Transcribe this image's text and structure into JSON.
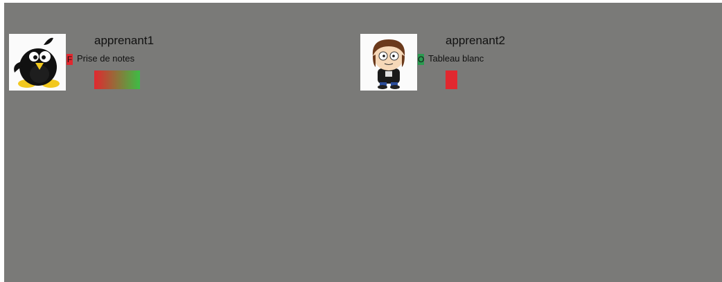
{
  "students": [
    {
      "name": "apprenant1",
      "avatar_icon": "penguin-avatar-icon",
      "status_letter": "F",
      "status_color": "#e1282f",
      "activity": "Prise de notes",
      "progress_gradient": [
        "#e1282f",
        "#3dbd45"
      ],
      "progress_level": 1.0
    },
    {
      "name": "apprenant2",
      "avatar_icon": "cartoon-boy-avatar-icon",
      "status_letter": "O",
      "status_color": "#2a9a50",
      "activity": "Tableau blanc",
      "progress_gradient": [
        "#e1282f",
        "#e1282f"
      ],
      "progress_level": 0.25
    }
  ]
}
